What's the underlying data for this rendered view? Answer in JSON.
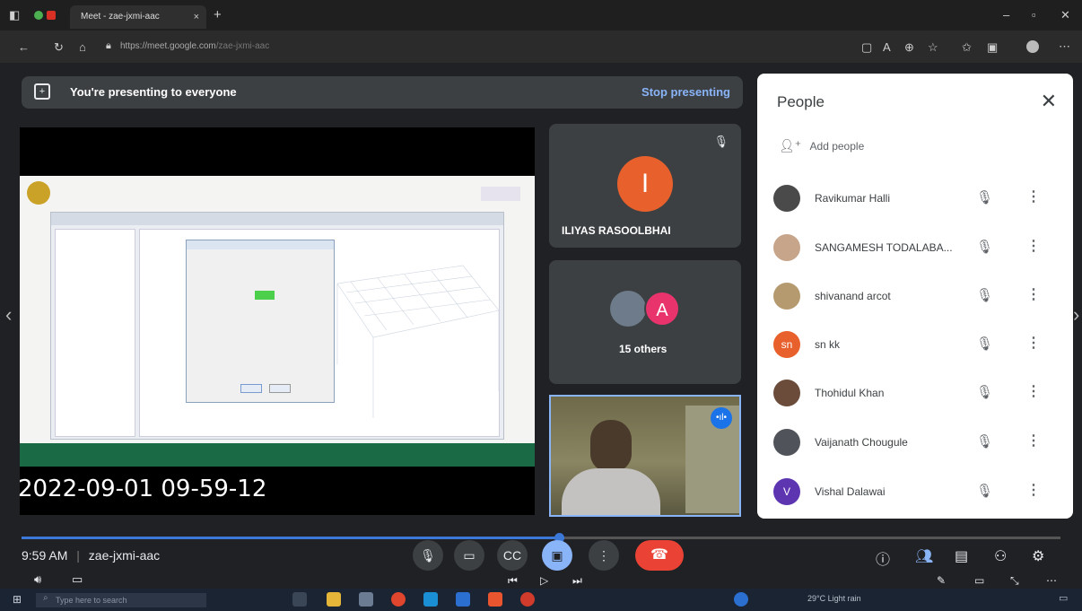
{
  "browser": {
    "tab_title": "Meet - zae-jxmi-aac",
    "tab_close": "×",
    "new_tab": "+",
    "url_host": "https://meet.google.com",
    "url_path": "/zae-jxmi-aac",
    "window_controls": [
      "–",
      "▫",
      "✕"
    ]
  },
  "banner": {
    "text": "You're presenting to everyone",
    "stop": "Stop presenting"
  },
  "presentation": {
    "timestamp": "2022-09-01 09-59-12"
  },
  "tiles": {
    "main_initial": "I",
    "main_name": "ILIYAS RASOOLBHAI",
    "group_initial": "A",
    "group_label": "15 others"
  },
  "people": {
    "title": "People",
    "close": "✕",
    "add_people": "Add people",
    "list": [
      {
        "name": "Ravikumar Halli",
        "avatar": "",
        "color": "#4a4a4a"
      },
      {
        "name": "SANGAMESH TODALABA...",
        "avatar": "",
        "color": "#c7a58a"
      },
      {
        "name": "shivanand arcot",
        "avatar": "",
        "color": "#b69a6f"
      },
      {
        "name": "sn kk",
        "avatar": "sn",
        "color": "#e8602c"
      },
      {
        "name": "Thohidul Khan",
        "avatar": "",
        "color": "#6b4c3b"
      },
      {
        "name": "Vaijanath Chougule",
        "avatar": "",
        "color": "#50545a"
      },
      {
        "name": "Vishal Dalawai",
        "avatar": "V",
        "color": "#5e35b1"
      }
    ]
  },
  "controls": {
    "time": "9:59 AM",
    "separator": "|",
    "meeting_code": "zae-jxmi-aac"
  },
  "taskbar": {
    "search_placeholder": "Type here to search",
    "weather": "29°C Light rain"
  }
}
